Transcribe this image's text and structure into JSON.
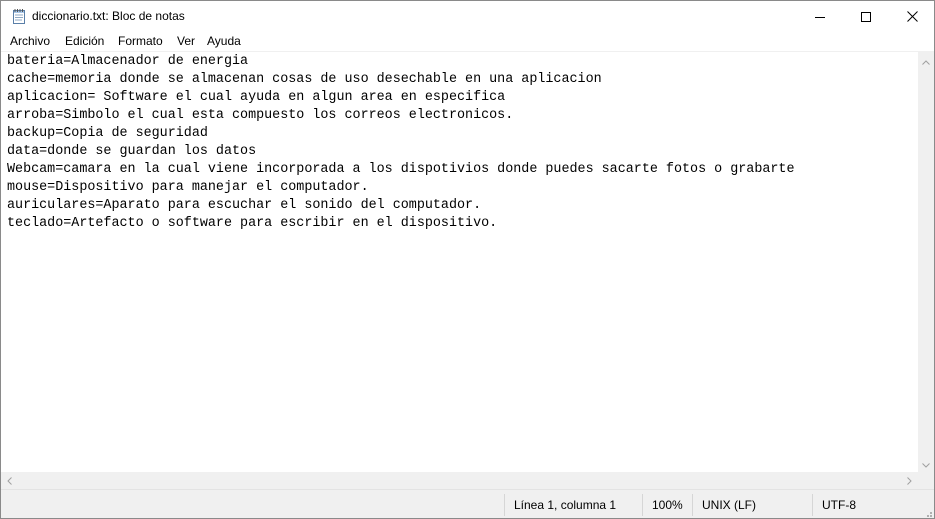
{
  "window": {
    "title": "diccionario.txt: Bloc de notas",
    "app_icon": "notepad-icon"
  },
  "controls": {
    "minimize_icon": "minimize-icon",
    "maximize_icon": "maximize-icon",
    "close_icon": "close-icon"
  },
  "menu": {
    "items": [
      {
        "label": "Archivo"
      },
      {
        "label": "Edición"
      },
      {
        "label": "Formato"
      },
      {
        "label": "Ver"
      },
      {
        "label": "Ayuda"
      }
    ]
  },
  "editor": {
    "lines": [
      "bateria=Almacenador de energia",
      "cache=memoria donde se almacenan cosas de uso desechable en una aplicacion",
      "aplicacion= Software el cual ayuda en algun area en especifica",
      "arroba=Simbolo el cual esta compuesto los correos electronicos.",
      "backup=Copia de seguridad",
      "data=donde se guardan los datos",
      "Webcam=camara en la cual viene incorporada a los dispotivios donde puedes sacarte fotos o grabarte",
      "mouse=Dispositivo para manejar el computador.",
      "auriculares=Aparato para escuchar el sonido del computador.",
      "teclado=Artefacto o software para escribir en el dispositivo."
    ]
  },
  "status": {
    "position": "Línea 1, columna 1",
    "zoom": "100%",
    "line_ending": "UNIX (LF)",
    "encoding": "UTF-8"
  },
  "colors": {
    "chrome": "#f0f0f0",
    "text": "#000000",
    "editor_bg": "#ffffff"
  }
}
